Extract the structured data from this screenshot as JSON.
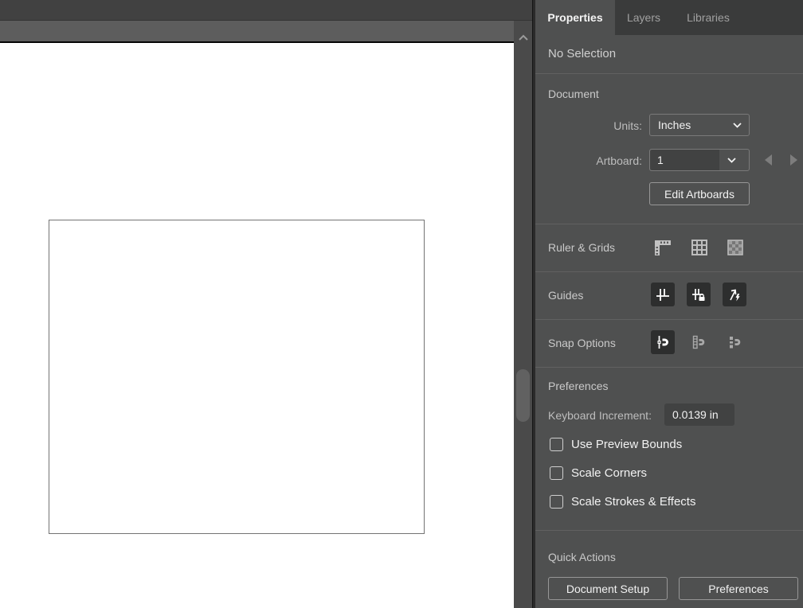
{
  "panel": {
    "tabs": [
      {
        "label": "Properties",
        "active": true
      },
      {
        "label": "Layers",
        "active": false
      },
      {
        "label": "Libraries",
        "active": false
      }
    ],
    "selection_status": "No Selection",
    "document": {
      "title": "Document",
      "units_label": "Units:",
      "units_value": "Inches",
      "artboard_label": "Artboard:",
      "artboard_value": "1",
      "edit_artboards_button": "Edit Artboards"
    },
    "ruler_grids": {
      "label": "Ruler & Grids",
      "icons": [
        {
          "name": "ruler-corner-icon",
          "active": false
        },
        {
          "name": "grid-icon",
          "active": false
        },
        {
          "name": "transparency-grid-icon",
          "active": false
        }
      ]
    },
    "guides": {
      "label": "Guides",
      "icons": [
        {
          "name": "show-guides-icon",
          "active": true
        },
        {
          "name": "lock-guides-icon",
          "active": true
        },
        {
          "name": "smart-guides-icon",
          "active": true
        }
      ]
    },
    "snap_options": {
      "label": "Snap Options",
      "icons": [
        {
          "name": "snap-to-point-icon",
          "active": true
        },
        {
          "name": "snap-to-grid-icon",
          "active": false
        },
        {
          "name": "snap-to-pixel-icon",
          "active": false
        }
      ]
    },
    "preferences": {
      "title": "Preferences",
      "keyboard_increment_label": "Keyboard Increment:",
      "keyboard_increment_value": "0.0139 in",
      "checkboxes": [
        {
          "label": "Use Preview Bounds",
          "checked": false
        },
        {
          "label": "Scale Corners",
          "checked": false
        },
        {
          "label": "Scale Strokes & Effects",
          "checked": false
        }
      ]
    },
    "quick_actions": {
      "title": "Quick Actions",
      "document_setup_button": "Document Setup",
      "preferences_button": "Preferences"
    }
  },
  "colors": {
    "panel_bg": "#4f5050",
    "tabbar_bg": "#3a3b3b",
    "field_bg": "#414242",
    "toggle_on_bg": "#2d2e2e",
    "divider": "#616161",
    "text_bright": "#f2f2f2",
    "text_dim": "#bdbdbd",
    "canvas_bg": "#ffffff",
    "artboard_border": "#737373",
    "scroll_track": "#4a4a4a",
    "scroll_thumb": "#616161"
  }
}
